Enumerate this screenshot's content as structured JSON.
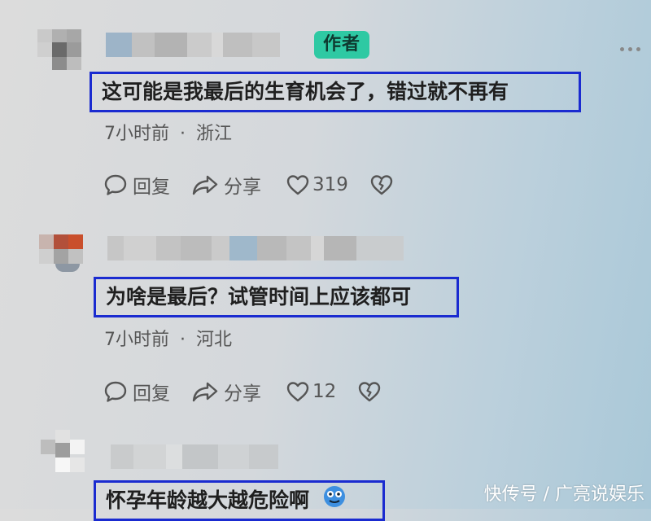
{
  "comments": [
    {
      "badge": "作者",
      "text": "这可能是我最后的生育机会了，错过就不再有",
      "time": "7小时前",
      "location": "浙江",
      "reply_label": "回复",
      "share_label": "分享",
      "likes": "319"
    },
    {
      "text": "为啥是最后？试管时间上应该都可",
      "time": "7小时前",
      "location": "河北",
      "reply_label": "回复",
      "share_label": "分享",
      "likes": "12"
    },
    {
      "text": "怀孕年龄越大越危险啊"
    }
  ],
  "separator": "·",
  "watermark": "快传号 / 广亮说娱乐",
  "colors": {
    "badge": "#2ec9a3",
    "highlight_box": "#1a2bd0"
  },
  "icons": [
    "more-icon",
    "comment-bubble-icon",
    "share-arrow-icon",
    "heart-icon",
    "broken-heart-icon",
    "blue-face-emoji-icon"
  ]
}
